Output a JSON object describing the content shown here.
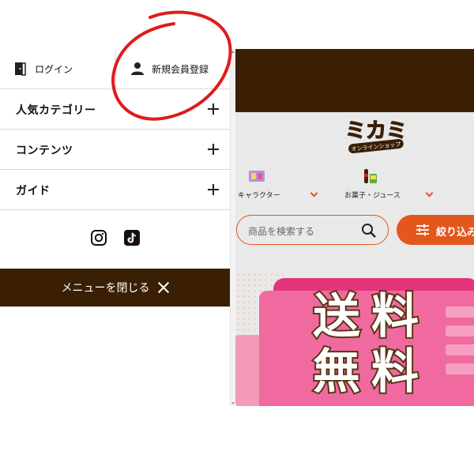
{
  "drawer": {
    "auth": {
      "login_label": "ログイン",
      "register_label": "新規会員登録"
    },
    "accordion": [
      {
        "label": "人気カテゴリー"
      },
      {
        "label": "コンテンツ"
      },
      {
        "label": "ガイド"
      }
    ],
    "social": [
      {
        "icon": "instagram-icon"
      },
      {
        "icon": "tiktok-icon"
      }
    ],
    "close_label": "メニューを閉じる"
  },
  "site": {
    "logo_text": "ミカミ",
    "logo_subtext": "オンラインショップ",
    "categories": [
      {
        "label": "キャラクター"
      },
      {
        "label": "お菓子・ジュース"
      }
    ],
    "search_placeholder": "商品を検索する",
    "filter_label": "絞り込み",
    "banner_text_line1": "送料",
    "banner_text_line2": "無料"
  },
  "colors": {
    "brand_brown": "#3a1f05",
    "accent_orange": "#e4571c",
    "banner_pink": "#e4347a",
    "annotation_red": "#e01b1b"
  }
}
